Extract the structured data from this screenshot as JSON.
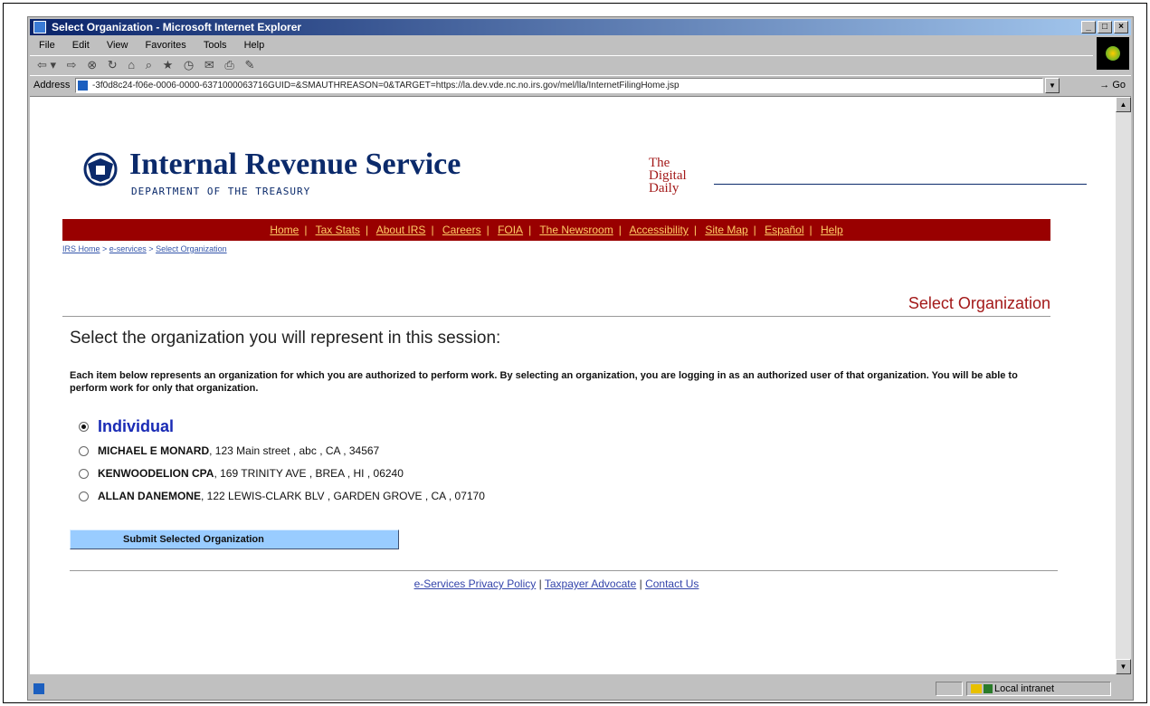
{
  "window": {
    "title": "Select Organization - Microsoft Internet Explorer"
  },
  "menu": [
    "File",
    "Edit",
    "View",
    "Favorites",
    "Tools",
    "Help"
  ],
  "address": {
    "label": "Address",
    "url": "-3f0d8c24-f06e-0006-0000-6371000063716GUID=&SMAUTHREASON=0&TARGET=https://la.dev.vde.nc.no.irs.gov/mel/lla/InternetFilingHome.jsp",
    "go_label": "Go"
  },
  "status": {
    "zone": "Local intranet"
  },
  "header": {
    "title": "Internal Revenue Service",
    "subtitle": "DEPARTMENT OF THE TREASURY",
    "digital_1": "The",
    "digital_2": "Digital",
    "digital_3": "Daily"
  },
  "nav": [
    "Home",
    "Tax Stats",
    "About IRS",
    "Careers",
    "FOIA",
    "The Newsroom",
    "Accessibility",
    "Site Map",
    "Español",
    "Help"
  ],
  "breadcrumb": [
    "IRS Home",
    "e-services",
    "Select Organization"
  ],
  "page": {
    "heading": "Select Organization",
    "prompt": "Select the organization you will represent in this session:",
    "description": "Each item below represents an organization for which you are authorized to perform work. By selecting an organization, you are logging in as an authorized user of that organization. You will be able to perform work for only that organization."
  },
  "organizations": [
    {
      "name": "Individual",
      "address": "",
      "selected": true
    },
    {
      "name": "MICHAEL E MONARD",
      "address": ", 123 Main street , abc , CA , 34567",
      "selected": false
    },
    {
      "name": "KENWOODELION CPA",
      "address": ", 169 TRINITY AVE , BREA , HI , 06240",
      "selected": false
    },
    {
      "name": "ALLAN DANEMONE",
      "address": ", 122 LEWIS-CLARK BLV , GARDEN GROVE , CA , 07170",
      "selected": false
    }
  ],
  "submit_label": "Submit Selected Organization",
  "footer": {
    "privacy": "e-Services Privacy Policy",
    "sep": "|",
    "advocate": "Taxpayer Advocate",
    "contact": "Contact Us"
  }
}
